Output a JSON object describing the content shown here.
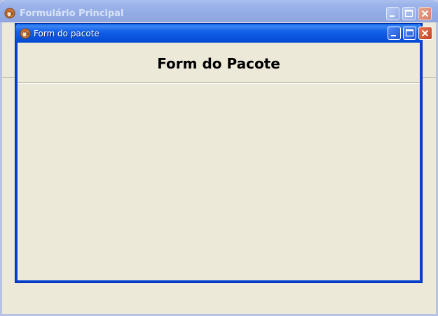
{
  "main_window": {
    "title": "Formulário Principal",
    "icon": "java-coffee-cup-icon",
    "state": "inactive"
  },
  "child_window": {
    "title": "Form do pacote",
    "icon": "java-coffee-cup-icon",
    "state": "active",
    "heading": "Form do Pacote"
  },
  "window_controls": [
    "minimize",
    "maximize",
    "close"
  ],
  "colors": {
    "active_titlebar": "#0a54df",
    "inactive_titlebar": "#9db4ea",
    "window_background": "#ece9d8",
    "close_button_active": "#d45a3a"
  }
}
